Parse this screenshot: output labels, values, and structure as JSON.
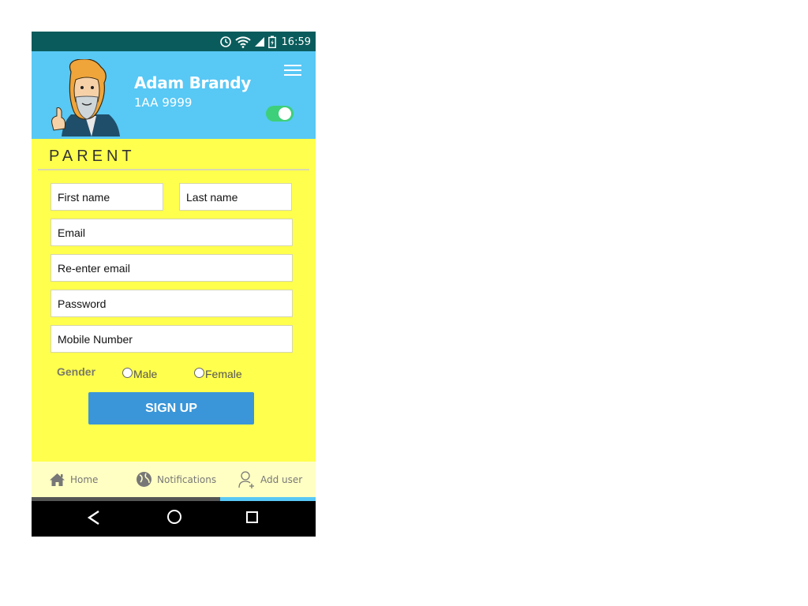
{
  "status_bar": {
    "time": "16:59",
    "icons": [
      "alarm-icon",
      "wifi-icon",
      "signal-icon",
      "battery-icon"
    ]
  },
  "header": {
    "user_name": "Adam Brandy",
    "user_id": "1AA 9999",
    "menu_icon": "hamburger-menu-icon",
    "toggle_state": "on",
    "colors": {
      "background": "#58c8f5",
      "toggle": "#3ecf7a"
    }
  },
  "form": {
    "section_title": "PARENT",
    "first_name_placeholder": "First name",
    "last_name_placeholder": "Last name",
    "email_placeholder": "Email",
    "reenter_email_placeholder": "Re-enter email",
    "password_placeholder": "Password",
    "mobile_placeholder": "Mobile Number",
    "gender_label": "Gender",
    "gender_options": [
      "Male",
      "Female"
    ],
    "signup_label": "SIGN UP",
    "colors": {
      "background": "#ffff4d",
      "button": "#3a96d8"
    }
  },
  "bottom_nav": {
    "items": [
      {
        "label": "Home",
        "icon": "home-icon"
      },
      {
        "label": "Notifications",
        "icon": "globe-icon"
      },
      {
        "label": "Add user",
        "icon": "add-user-icon"
      }
    ],
    "active": "Add user"
  },
  "system_nav": {
    "buttons": [
      "back-icon",
      "home-circle-icon",
      "recents-icon"
    ]
  }
}
